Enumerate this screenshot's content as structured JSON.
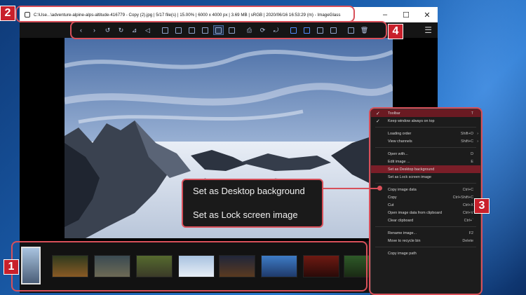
{
  "window": {
    "title": "C:\\Use...\\adventure-alpine-alps-altitude-416779 - Copy (2).jpg  |  5/17 file(s)  |  15.00%  |  6000 x 4000 px  |  3.69 MB  |  sRGB  |  2020/06/16 16:53:29 (m)  - ImageGlass",
    "controls": [
      "–",
      "☐",
      "✕"
    ]
  },
  "markers": [
    "1",
    "2",
    "3",
    "4"
  ],
  "toolbar": {
    "buttons": [
      {
        "icon": "arrow-left-icon",
        "glyph": "‹"
      },
      {
        "icon": "arrow-right-icon",
        "glyph": "›"
      },
      {
        "icon": "rotate-left-icon",
        "glyph": "↺"
      },
      {
        "icon": "rotate-right-icon",
        "glyph": "↻"
      },
      {
        "icon": "flip-horizontal-icon",
        "glyph": "⊿"
      },
      {
        "icon": "flip-vertical-icon",
        "glyph": "◁"
      },
      {
        "icon": "zoom-fit-icon",
        "glyph": ""
      },
      {
        "icon": "actual-size-icon",
        "glyph": ""
      },
      {
        "icon": "scale-width-icon",
        "glyph": ""
      },
      {
        "icon": "scale-height-icon",
        "glyph": ""
      },
      {
        "icon": "auto-zoom-icon",
        "glyph": ""
      },
      {
        "icon": "lock-zoom-icon",
        "glyph": ""
      },
      {
        "icon": "print-icon",
        "glyph": "⎙"
      },
      {
        "icon": "refresh-icon",
        "glyph": "⟳"
      },
      {
        "icon": "slideshow-icon",
        "glyph": "⤾"
      },
      {
        "icon": "thumbnail-bar-icon",
        "glyph": ""
      },
      {
        "icon": "fullscreen-icon",
        "glyph": ""
      },
      {
        "icon": "checkerboard-icon",
        "glyph": ""
      },
      {
        "icon": "gallery-icon",
        "glyph": ""
      },
      {
        "icon": "grid-icon",
        "glyph": ""
      },
      {
        "icon": "delete-icon",
        "glyph": "🗑"
      }
    ],
    "menu_glyph": "☰"
  },
  "context_menu": {
    "items": [
      {
        "label": "Toolbar",
        "shortcut": "T",
        "checked": true,
        "state": "highlight"
      },
      {
        "label": "Keep window always on top",
        "shortcut": "",
        "checked": true
      },
      {
        "sep": true
      },
      {
        "label": "Loading order",
        "shortcut": "Shift+O",
        "submenu": true
      },
      {
        "label": "View channels",
        "shortcut": "Shift+C",
        "submenu": true
      },
      {
        "sep": true
      },
      {
        "label": "Open with...",
        "shortcut": "D"
      },
      {
        "label": "Edit image ...",
        "shortcut": "E"
      },
      {
        "label": "Set as Desktop background",
        "shortcut": "",
        "state": "hover"
      },
      {
        "label": "Set as Lock screen image",
        "shortcut": ""
      },
      {
        "sep": true
      },
      {
        "label": "Copy image data",
        "shortcut": "Ctrl+C"
      },
      {
        "label": "Copy",
        "shortcut": "Ctrl+Shift+C"
      },
      {
        "label": "Cut",
        "shortcut": "Ctrl+X"
      },
      {
        "label": "Open image data from clipboard",
        "shortcut": "Ctrl+V"
      },
      {
        "label": "Clear clipboard",
        "shortcut": "Ctrl+`"
      },
      {
        "sep": true
      },
      {
        "label": "Rename image...",
        "shortcut": "F2"
      },
      {
        "label": "Move to recycle bin",
        "shortcut": "Delete"
      },
      {
        "sep": true
      },
      {
        "label": "Copy image path",
        "shortcut": ""
      }
    ]
  },
  "zoom_callout": {
    "line1": "Set as Desktop background",
    "line2": "Set as Lock screen image"
  },
  "thumbnails": [
    {
      "colors": [
        "#a9c3df",
        "#4b5e78"
      ],
      "selected": true
    },
    {
      "colors": [
        "#2f3a1e",
        "#8a5a24"
      ]
    },
    {
      "colors": [
        "#3a4a52",
        "#6d6a55"
      ]
    },
    {
      "colors": [
        "#556a2e",
        "#3b3b28"
      ]
    },
    {
      "colors": [
        "#a8c2e0",
        "#e8eef6"
      ]
    },
    {
      "colors": [
        "#20263a",
        "#5a3a20"
      ]
    },
    {
      "colors": [
        "#3e7cc6",
        "#1f3a6a"
      ]
    },
    {
      "colors": [
        "#6e1a12",
        "#2a0a08"
      ]
    },
    {
      "colors": [
        "#2e5a28",
        "#1a2a14"
      ]
    }
  ]
}
